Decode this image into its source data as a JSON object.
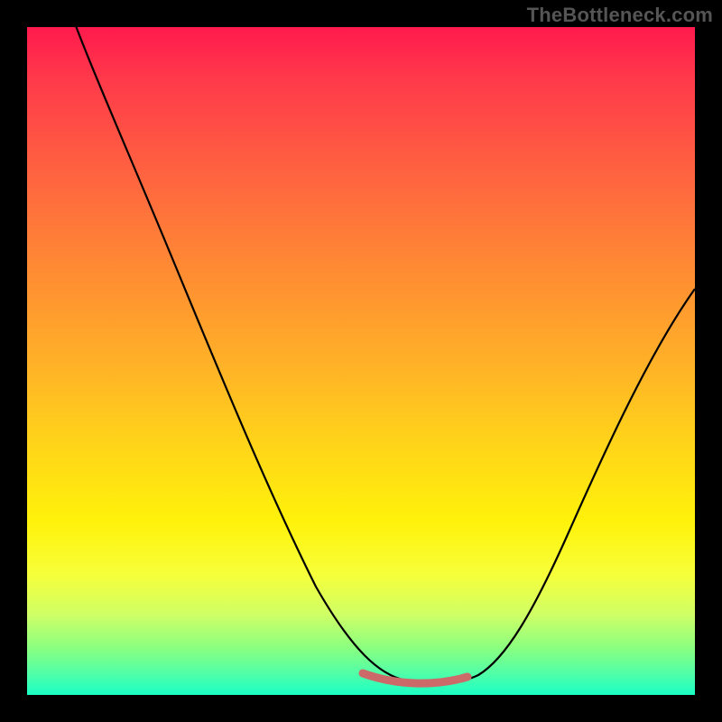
{
  "watermark": "TheBottleneck.com",
  "chart_data": {
    "type": "line",
    "title": "",
    "xlabel": "",
    "ylabel": "",
    "xlim": [
      0,
      100
    ],
    "ylim": [
      0,
      100
    ],
    "grid": false,
    "legend": false,
    "background": "heatmap-gradient red→yellow→green",
    "series": [
      {
        "name": "bottleneck-curve",
        "x": [
          0,
          4,
          10,
          18,
          26,
          34,
          40,
          46,
          50,
          54,
          58,
          62,
          66,
          70,
          76,
          82,
          88,
          94,
          100
        ],
        "y": [
          105,
          96,
          84,
          70,
          56,
          42,
          30,
          18,
          9,
          3,
          1,
          0,
          1,
          4,
          12,
          24,
          38,
          52,
          60
        ]
      }
    ],
    "annotations": [
      {
        "name": "optimal-range",
        "x_start": 50,
        "x_end": 66,
        "y": 1
      }
    ],
    "notes": "V-shaped bottleneck curve over continuous color field; red=high bottleneck, green=balanced. Pink/salmon band marks the flat valley (optimal configuration)."
  }
}
